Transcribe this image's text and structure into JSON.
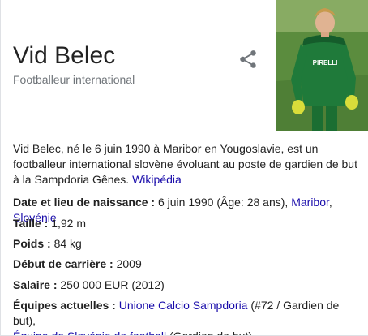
{
  "entity": {
    "name": "Vid Belec",
    "subtitle": "Footballeur international"
  },
  "share_icon": "share-icon",
  "photo_icon": "player-photo",
  "description": {
    "text": "Vid Belec, né le 6 juin 1990 à Maribor en Yougoslavie, est un footballeur international slovène évoluant au poste de gardien de but à la Sampdoria Gênes.",
    "source_link": "Wikipédia"
  },
  "facts": {
    "birth": {
      "label": "Date et lieu de naissance :",
      "value": "6 juin 1990 (Âge: 28 ans),",
      "link1": "Maribor",
      "sep": ",",
      "link2": "Slovénie"
    },
    "height": {
      "label": "Taille :",
      "value": "1,92 m"
    },
    "weight": {
      "label": "Poids :",
      "value": "84 kg"
    },
    "career_start": {
      "label": "Début de carrière :",
      "value": "2009"
    },
    "salary": {
      "label": "Salaire :",
      "value": "250 000 EUR (2012)"
    },
    "teams": {
      "label": "Équipes actuelles :",
      "link1": "Unione Calcio Sampdoria",
      "text1": "(#72 / Gardien de but),",
      "link2": "Équipe de Slovénie de football",
      "text2": "(Gardien de but)"
    }
  },
  "colors": {
    "link": "#1a0dab",
    "muted": "#70757a",
    "jersey": "#1f7a3a",
    "grass": "#5b8c3e"
  }
}
